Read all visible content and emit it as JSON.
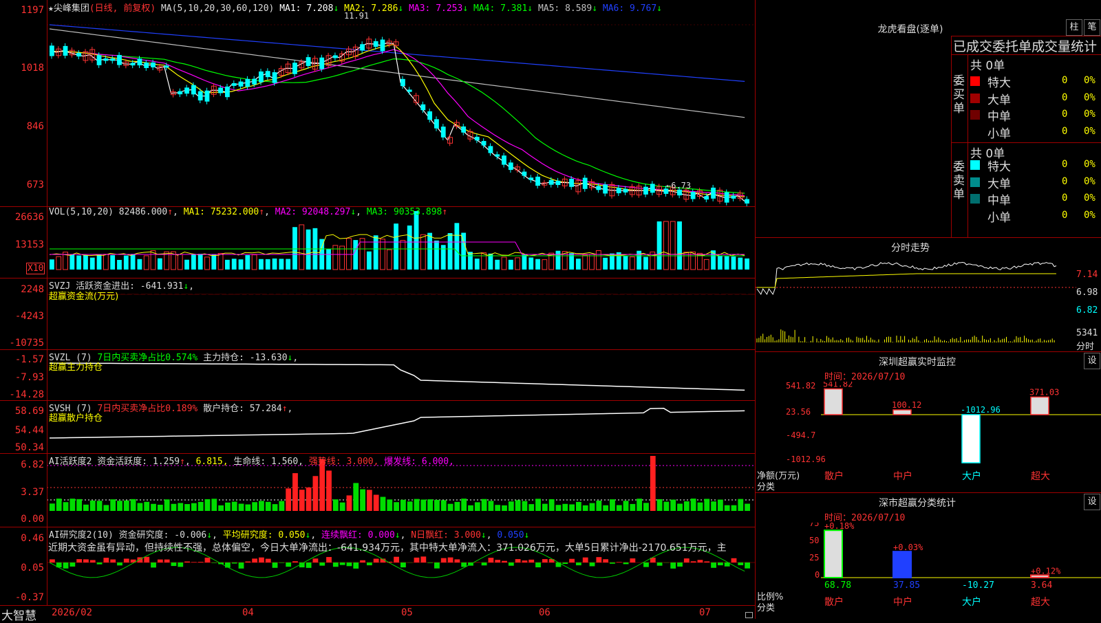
{
  "stock": {
    "name": "尖峰集团",
    "mode": "(日线, 前复权)",
    "ma_label": "MA(5,10,20,30,60,120)"
  },
  "ma_values": [
    {
      "label": "MA1: 7.208",
      "arrow": "↓",
      "color": "#ffffff"
    },
    {
      "label": "MA2: 7.286",
      "arrow": "↓",
      "color": "#ffff00"
    },
    {
      "label": "MA3: 7.253",
      "arrow": "↓",
      "color": "#ff00ff"
    },
    {
      "label": "MA4: 7.381",
      "arrow": "↓",
      "color": "#00ff00"
    },
    {
      "label": "MA5: 8.589",
      "arrow": "↓",
      "color": "#c0c0c0"
    },
    {
      "label": "MA6: 9.767",
      "arrow": "↓",
      "color": "#2040ff"
    }
  ],
  "price_axis": [
    "1197",
    "1018",
    "846",
    "673"
  ],
  "price_marks": {
    "high": "11.91",
    "low": "6.73"
  },
  "vol": {
    "header": "VOL(5,10,20)",
    "value": "82486.000",
    "ma1": "MA1: 75232.000",
    "ma2": "MA2: 92048.297",
    "ma3": "MA3: 90353.898",
    "axis": [
      "26636",
      "13153"
    ],
    "unit": "X10"
  },
  "svzj": {
    "header": "SVZJ  活跃资金进出: -641.931",
    "sub": "超赢资金流(万元)",
    "axis": [
      "2248",
      "-4243",
      "-10735"
    ]
  },
  "svzl": {
    "header_a": "SVZL (7)",
    "header_b": "7日内买卖净占比0.574%",
    "header_c": "主力持仓: -13.630",
    "sub": "超赢主力持仓",
    "axis": [
      "-1.57",
      "-7.93",
      "-14.28"
    ]
  },
  "svsh": {
    "header_a": "SVSH (7)",
    "header_b": "7日内买卖净占比0.189%",
    "header_c": "散户持仓: 57.284",
    "sub": "超赢散户持仓",
    "axis": [
      "58.69",
      "54.44",
      "50.34"
    ]
  },
  "ai1": {
    "a": "AI活跃度2 资金活跃度: 1.259",
    "b": "6.815,",
    "c": "生命线: 1.560,",
    "d": "强势线: 3.000,",
    "e": "爆发线: 6.000,",
    "axis": [
      "6.82",
      "3.37",
      "0.00"
    ]
  },
  "ai2": {
    "a": "AI研究度2(10) 资金研究度: -0.006",
    "b": "平均研究度: 0.050",
    "c": "连续飘红: 0.000",
    "d": "N日飘红: 3.000",
    "e": "0.050",
    "axis": [
      "0.46",
      "0.05",
      "-0.37"
    ],
    "comment": "近期大资金虽有异动，但持续性不强，总体偏空，今日大单净流出：-641.934万元，其中特大单净流入：371.026万元，大单5日累计净出-2170.651万元，主"
  },
  "xaxis": [
    "2026/02",
    "04",
    "05",
    "06",
    "07"
  ],
  "brand": "大智慧",
  "right": {
    "lhb_title": "龙虎看盘(逐单)",
    "btn_zhu": "柱",
    "btn_bi": "笔",
    "stat_title": "已成交委托单成交量统计",
    "buy_label": "委买单",
    "sell_label": "委卖单",
    "buy_total": "共 0单",
    "sell_total": "共 0单",
    "rows": [
      {
        "name": "特大",
        "cnt": "0",
        "pct": "0%",
        "color": "#ff0000"
      },
      {
        "name": "大单",
        "cnt": "0",
        "pct": "0%",
        "color": "#a00000"
      },
      {
        "name": "中单",
        "cnt": "0",
        "pct": "0%",
        "color": "#700000"
      },
      {
        "name": "小单",
        "cnt": "0",
        "pct": "0%",
        "color": "#000000"
      }
    ],
    "sell_rows": [
      {
        "name": "特大",
        "cnt": "0",
        "pct": "0%",
        "color": "#00ffff"
      },
      {
        "name": "大单",
        "cnt": "0",
        "pct": "0%",
        "color": "#008c8c"
      },
      {
        "name": "中单",
        "cnt": "0",
        "pct": "0%",
        "color": "#006e6e"
      },
      {
        "name": "小单",
        "cnt": "0",
        "pct": "0%",
        "color": "#000000"
      }
    ],
    "fenshi_title": "分时走势",
    "fenshi_axis": [
      "7.14",
      "6.98",
      "6.82",
      "5341"
    ],
    "fenshi_unit": "分时",
    "sz_title": "深圳超赢实时监控",
    "set": "设",
    "sz_time": "时间：2026/07/10",
    "sz_axis": [
      "541.82",
      "23.56",
      "-494.7",
      "-1012.96"
    ],
    "sz_unit": "净额(万元)",
    "sz_cat": "分类",
    "sz_bars": [
      {
        "label": "541.82",
        "value": 541.82
      },
      {
        "label": "100.12",
        "value": 100.12
      },
      {
        "label": "-1012.96",
        "value": -1012.96
      },
      {
        "label": "371.03",
        "value": 371.03
      }
    ],
    "cats": [
      "散户",
      "中户",
      "大户",
      "超大"
    ],
    "ss_title": "深市超赢分类统计",
    "ss_time": "时间：2026/07/10",
    "ss_axis": [
      "75",
      "50",
      "25",
      "0"
    ],
    "ss_unit": "比例%",
    "ss_cat": "分类",
    "ss_bars": [
      {
        "top": "+0.18%",
        "value": 68.78,
        "bottom": "68.78"
      },
      {
        "top": "+0.03%",
        "value": 37.85,
        "bottom": "37.85"
      },
      {
        "top": "",
        "value": -10.27,
        "bottom": "-10.27"
      },
      {
        "top": "+0.12%",
        "value": 3.64,
        "bottom": "3.64"
      }
    ]
  }
}
